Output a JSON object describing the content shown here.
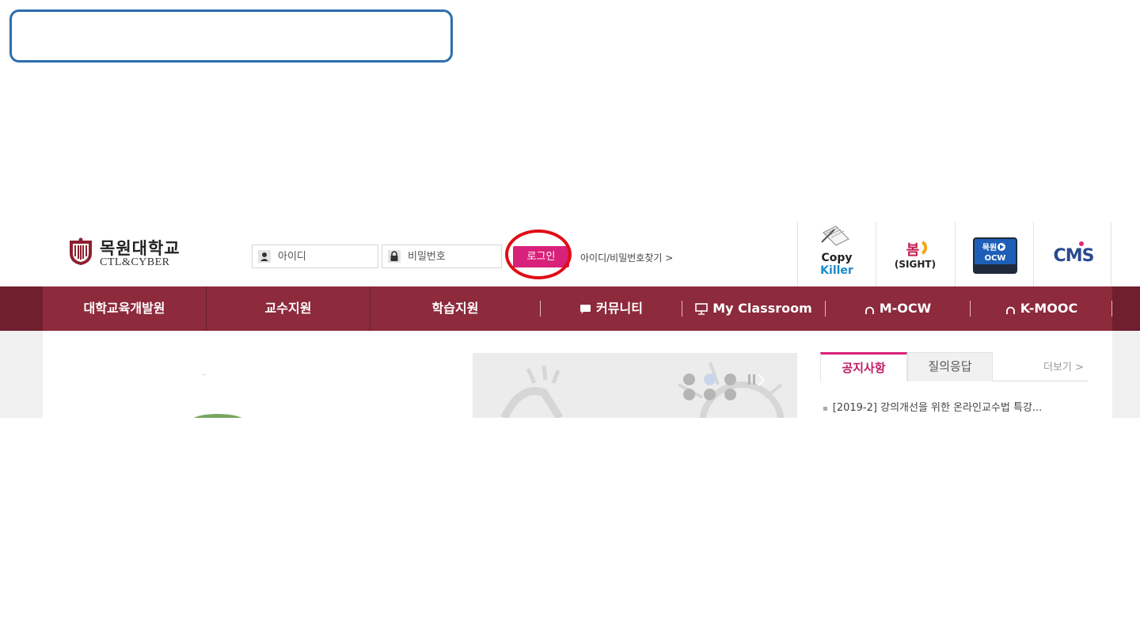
{
  "header": {
    "logo_name": "목원대학교",
    "logo_sub": "CTL&CYBER",
    "id_placeholder": "아이디",
    "pw_placeholder": "비밀번호",
    "login_label": "로그인",
    "find_link": "아이디/비밀번호찾기 >"
  },
  "quick_links": {
    "copykiller_top": "Copy",
    "copykiller_bottom": "Killer",
    "bom_top": "봄",
    "bom_bottom": "(SIGHT)",
    "ocw_top": "목원",
    "ocw_bottom": "OCW",
    "cms": "CMS"
  },
  "nav": {
    "items": [
      "대학교육개발원",
      "교수지원",
      "학습지원",
      "커뮤니티",
      "My Classroom",
      "M-OCW",
      "K-MOOC"
    ]
  },
  "board": {
    "tab_notice": "공지사항",
    "tab_qna": "질의응답",
    "more": "더보기 >",
    "items": [
      "[2019-2] 강의개선을 위한 온라인교수법 특강..."
    ]
  },
  "colors": {
    "nav_bg": "#8d2a3c",
    "accent": "#d8217a",
    "callout_border": "#2e6dad",
    "highlight_ring": "#e00d16"
  }
}
